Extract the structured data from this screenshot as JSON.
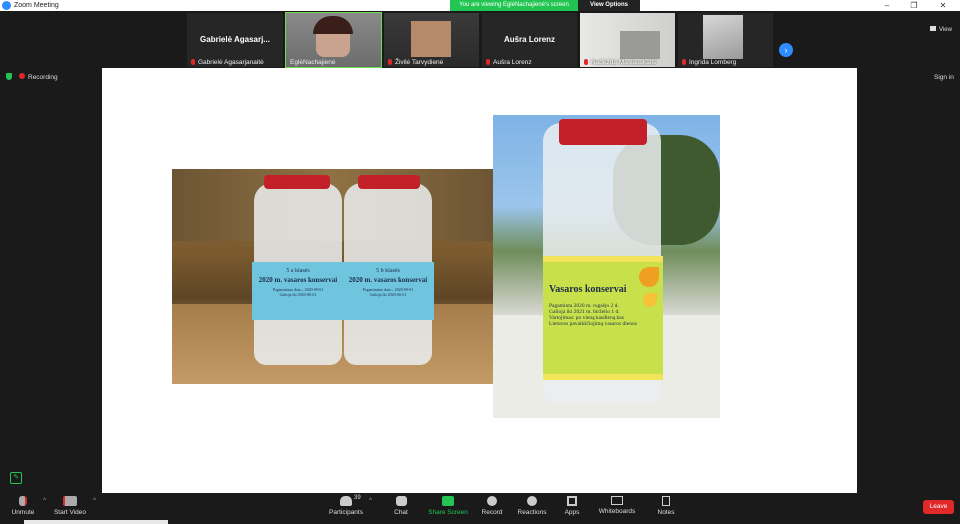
{
  "window": {
    "title": "Zoom Meeting",
    "minimize": "‒",
    "maximize": "❐",
    "close": "✕"
  },
  "banner": {
    "viewing": "You are viewing EglėNachajienė's screen",
    "view_options": "View Options"
  },
  "gallery": {
    "tiles": [
      {
        "big_name": "Gabrielė  Agasarj...",
        "caption": "Gabrielė Agasarjanaitė"
      },
      {
        "caption": "EglėNachajienė"
      },
      {
        "caption": "Živilė Tarvydienė"
      },
      {
        "big_name": "Aušra Lorenz",
        "caption": "Aušra Lorenz"
      },
      {
        "caption": "Nadežda Maslauskaitė"
      },
      {
        "caption": "Ingrida Lomberg"
      }
    ],
    "next": "›",
    "view": "View"
  },
  "status": {
    "recording": "Recording",
    "sign_in": "Sign in"
  },
  "shared": {
    "jar_left": {
      "lines": [
        "5 a klasės",
        "2020 m. vasaros konservai",
        "Pagaminimo data – 2020-09-01",
        "Galioja iki 2020-06-01"
      ]
    },
    "jar_middle": {
      "lines": [
        "5 b klasės",
        "2020 m. vasaros konservai",
        "Pagaminimo data – 2020-09-01",
        "Galioja iki 2020-06-01"
      ]
    },
    "jar_right": {
      "lines": [
        "Vasaros konservai",
        "Pagaminta 2020 m. rugsėjo 2 d.",
        "Galioja iki 2021 m. birželio 1 d.",
        "Vartojimas: po vieną kasdieną kas",
        "Lietuvos pavaikščiojimų vasaros dienos"
      ]
    }
  },
  "toolbar": {
    "unmute": "Unmute",
    "start_video": "Start Video",
    "participants": "Participants",
    "participants_count": "39",
    "chat": "Chat",
    "share_screen": "Share Screen",
    "record": "Record",
    "reactions": "Reactions",
    "apps": "Apps",
    "whiteboards": "Whiteboards",
    "notes": "Notes",
    "leave": "Leave"
  },
  "colors": {
    "accent": "#2d8cff",
    "share_green": "#23c552",
    "leave_red": "#e02828",
    "jar_lid": "#c3202a",
    "label_blue": "#6fc4de",
    "label_yellow": "#c8e04a"
  }
}
